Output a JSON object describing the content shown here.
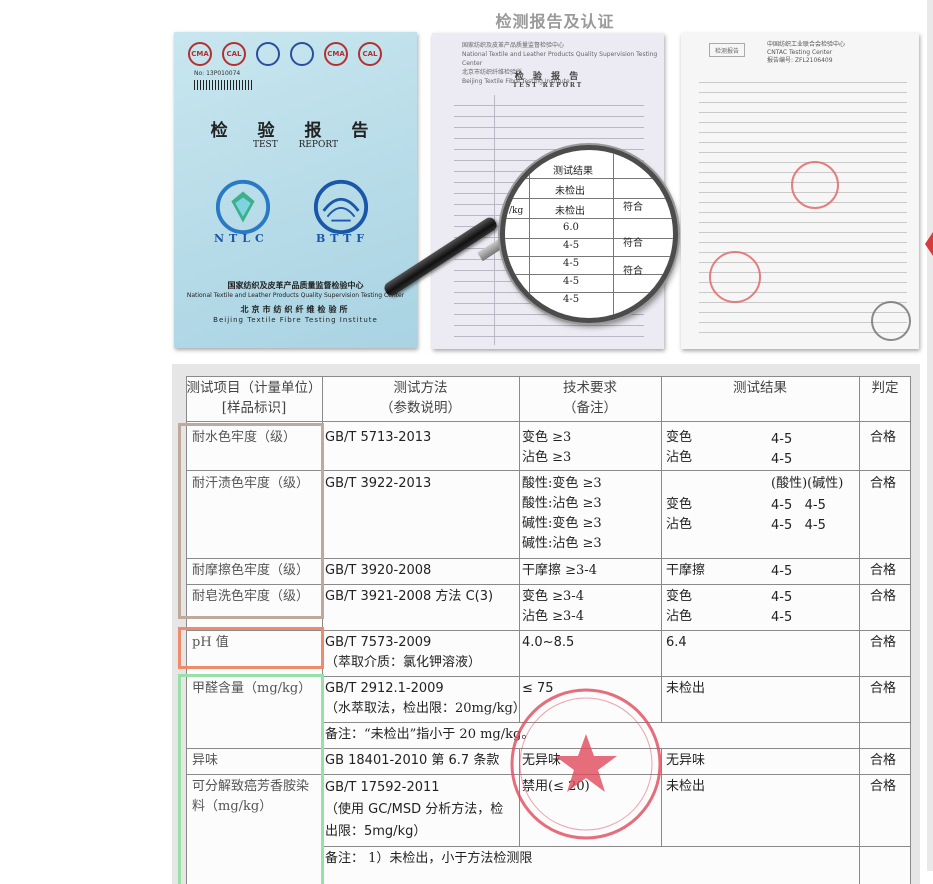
{
  "page_title": "检测报告及认证",
  "cover": {
    "logos": [
      "CMA",
      "CAL",
      "",
      "",
      "CMA",
      "CAL"
    ],
    "report_no": "No: 13P010074",
    "title_cn": "检 验 报 告",
    "title_en": "TEST   REPORT",
    "emblem_left": "NTLC",
    "emblem_right": "BTTF",
    "org_cn_1": "国家纺织及皮革产品质量监督检验中心",
    "org_en_1": "National Textile and Leather Products Quality Supervision Testing Center",
    "org_cn_2": "北京市纺织纤维检验所",
    "org_en_2": "Beijing Textile Fibre Testing Institute"
  },
  "report": {
    "header_cn": "国家纺织及皮革产品质量监督检验中心",
    "header_en": "National Textile and Leather Products Quality Supervision Testing Center",
    "header_cn2": "北京市纺织纤维检验所",
    "header_en2": "Beijing Textile Fibre Testing Institute",
    "title": "检 验 报 告",
    "title_en": "TEST  REPORT",
    "magnifier": {
      "heading": "测试结果",
      "rows": [
        "未检出",
        "未检出",
        "6.0",
        "4-5",
        "4-5",
        "4-5",
        "4-5",
        "4-5"
      ],
      "side": [
        "符合",
        "符合",
        "符合"
      ],
      "unit": "/kg"
    }
  },
  "results": {
    "title": "检测报告",
    "org_cn": "中国纺织工业联合会检验中心",
    "org_en": "CNTAC Testing Center",
    "report_no": "报告编号: ZFL2106409",
    "seal": "CNAS"
  },
  "table": {
    "headers": {
      "item": [
        "测试项目（计量单位）",
        "[样品标识]"
      ],
      "method": [
        "测试方法",
        "（参数说明）"
      ],
      "requirement": [
        "技术要求",
        "（备注）"
      ],
      "result": "测试结果",
      "verdict": "判定"
    },
    "rows": [
      {
        "item": [
          "耐水色牢度（级）"
        ],
        "method": [
          "GB/T 5713-2013"
        ],
        "req": [
          "变色 ≥3",
          "沾色 ≥3"
        ],
        "res_label": [
          "变色",
          "沾色"
        ],
        "res_val": [
          "4-5",
          "4-5"
        ],
        "verdict": "合格"
      },
      {
        "item": [
          "耐汗渍色牢度（级）"
        ],
        "method": [
          "GB/T 3922-2013"
        ],
        "req": [
          "酸性:变色 ≥3",
          "酸性:沾色 ≥3",
          "碱性:变色 ≥3",
          "碱性:沾色 ≥3"
        ],
        "res_header": "(酸性)(碱性)",
        "res_label": [
          "变色",
          "沾色"
        ],
        "res_val": [
          "4-5   4-5",
          "4-5   4-5"
        ],
        "verdict": "合格"
      },
      {
        "item": [
          "耐摩擦色牢度（级）"
        ],
        "method": [
          "GB/T 3920-2008"
        ],
        "req": [
          "干摩擦 ≥3-4"
        ],
        "res_label": [
          "干摩擦"
        ],
        "res_val": [
          "4-5"
        ],
        "verdict": "合格"
      },
      {
        "item": [
          "耐皂洗色牢度（级）"
        ],
        "method": [
          "GB/T 3921-2008 方法 C(3)"
        ],
        "req": [
          "变色 ≥3-4",
          "沾色 ≥3-4"
        ],
        "res_label": [
          "变色",
          "沾色"
        ],
        "res_val": [
          "4-5",
          "4-5"
        ],
        "verdict": "合格"
      },
      {
        "item": [
          "pH 值"
        ],
        "method": [
          "GB/T 7573-2009",
          "（萃取介质：氯化钾溶液）"
        ],
        "req": [
          "4.0~8.5"
        ],
        "res_label": [
          "6.4"
        ],
        "res_val": [],
        "verdict": "合格"
      },
      {
        "item": [
          "甲醛含量（mg/kg）"
        ],
        "method": [
          "GB/T 2912.1-2009",
          "（水萃取法，检出限：20mg/kg）"
        ],
        "req": [
          "≤ 75"
        ],
        "res_label": [
          "未检出"
        ],
        "res_val": [],
        "verdict": "合格",
        "note": "备注：“未检出”指小于 20 mg/kg。"
      },
      {
        "item": [
          "异味"
        ],
        "method": [
          "GB 18401-2010 第 6.7 条款"
        ],
        "req": [
          "无异味"
        ],
        "res_label": [
          "无异味"
        ],
        "res_val": [],
        "verdict": "合格"
      },
      {
        "item": [
          "可分解致癌芳香胺染",
          "料（mg/kg）"
        ],
        "method": [
          "GB/T 17592-2011",
          "（使用 GC/MSD 分析方法，检",
          "出限：5mg/kg）"
        ],
        "req": [
          "禁用(≤ 20)"
        ],
        "res_label": [
          "未检出"
        ],
        "res_val": [],
        "verdict": "合格",
        "note": "备注：  1）未检出，小于方法检测限"
      }
    ]
  },
  "colors": {
    "box_colorfastness": "#bfa89c",
    "box_ph": "#f08a6a",
    "box_formaldehyde": "#97e0a6",
    "stamp": "#e0485a",
    "page_title": "#9a9a9a"
  }
}
